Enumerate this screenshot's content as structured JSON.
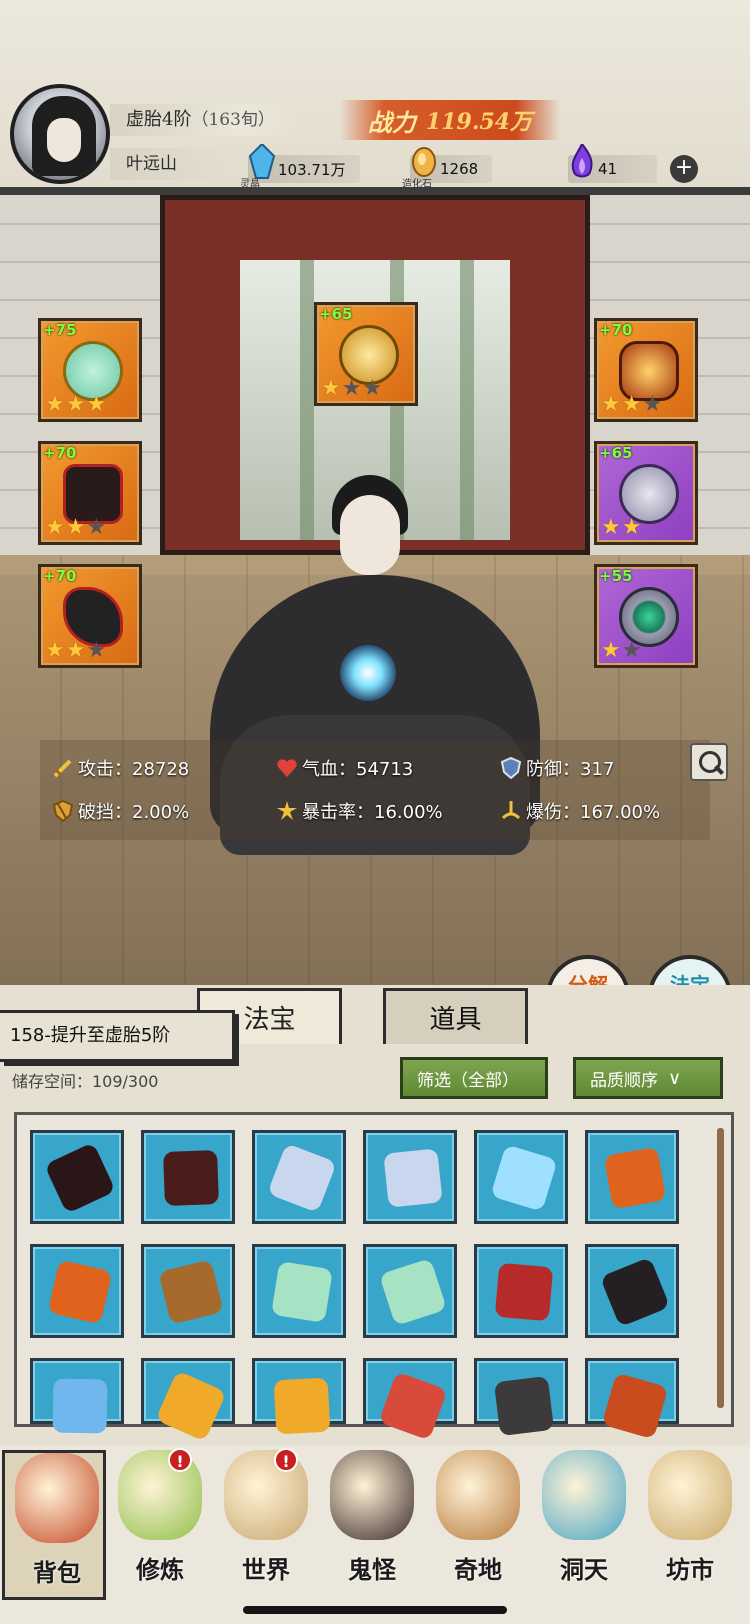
{
  "header": {
    "realm": "虚胎4阶",
    "age": "（163旬）",
    "player_name": "叶远山",
    "power_label": "战力",
    "power_value": "119.54万",
    "resources": [
      {
        "icon": "spirit-crystal-icon",
        "caption": "灵晶",
        "value": "103.71万"
      },
      {
        "icon": "creation-stone-icon",
        "caption": "造化石",
        "value": "1268"
      },
      {
        "icon": "purple-flame-icon",
        "caption": "",
        "value": "41"
      }
    ],
    "plus_label": "+"
  },
  "equipment": [
    {
      "slot": "left-1",
      "level": "+75",
      "stars": 3,
      "max_stars": 3,
      "rarity": "orange",
      "icon": "fan-icon"
    },
    {
      "slot": "left-2",
      "level": "+70",
      "stars": 2,
      "max_stars": 3,
      "rarity": "orange",
      "icon": "robe-icon"
    },
    {
      "slot": "left-3",
      "level": "+70",
      "stars": 2,
      "max_stars": 3,
      "rarity": "orange",
      "icon": "boots-icon"
    },
    {
      "slot": "top",
      "level": "+65",
      "stars": 1,
      "max_stars": 3,
      "rarity": "orange",
      "icon": "cloud-ornament-icon"
    },
    {
      "slot": "right-1",
      "level": "+70",
      "stars": 2,
      "max_stars": 3,
      "rarity": "orange",
      "icon": "crown-icon"
    },
    {
      "slot": "right-2",
      "level": "+65",
      "stars": 2,
      "max_stars": 2,
      "rarity": "purple",
      "icon": "pendant-icon"
    },
    {
      "slot": "right-3",
      "level": "+55",
      "stars": 1,
      "max_stars": 2,
      "rarity": "purple",
      "icon": "ring-icon"
    }
  ],
  "stats": {
    "attack": "攻击：28728",
    "hp": "气血：54713",
    "defense": "防御：317",
    "break_block": "破挡：2.00%",
    "crit_rate": "暴击率：16.00%",
    "crit_damage": "爆伤：167.00%"
  },
  "actions": {
    "decompose": "分解\n再造",
    "synthesize": "法宝\n合成"
  },
  "bag": {
    "tabs": [
      "法宝",
      "道具"
    ],
    "active_tab": 0,
    "quest": "158-提升至虚胎5阶",
    "capacity": "储存空间：109/300",
    "filter": "筛选（全部）",
    "sort": "品质顺序",
    "items": [
      "blade-icon",
      "spiked-wheel-icon",
      "silver-sword-icon",
      "silver-sword-icon",
      "ice-bow-icon",
      "fire-axe-icon",
      "fire-axe-icon",
      "staff-icon",
      "fan-icon",
      "fan-icon",
      "demon-mask-icon",
      "boots-icon",
      "crystal-claw-icon",
      "golden-wing-icon",
      "golden-wing-icon",
      "feather-crown-icon",
      "dagger-icon",
      "lion-mask-icon"
    ]
  },
  "nav": {
    "items": [
      {
        "label": "背包",
        "icon": "bag-icon",
        "badge": ""
      },
      {
        "label": "修炼",
        "icon": "lotus-icon",
        "badge": "!"
      },
      {
        "label": "世界",
        "icon": "scroll-map-icon",
        "badge": "!"
      },
      {
        "label": "鬼怪",
        "icon": "demon-egg-icon",
        "badge": ""
      },
      {
        "label": "奇地",
        "icon": "mystic-land-icon",
        "badge": ""
      },
      {
        "label": "洞天",
        "icon": "portal-icon",
        "badge": ""
      },
      {
        "label": "坊市",
        "icon": "market-icon",
        "badge": ""
      }
    ],
    "active": 0
  },
  "colors": {
    "orange_frame": "#e67e22",
    "purple_frame": "#9b4fd0",
    "slot_blue": "#38a5cb",
    "level_green": "#7dff3a",
    "star_gold": "#ffc93b"
  }
}
